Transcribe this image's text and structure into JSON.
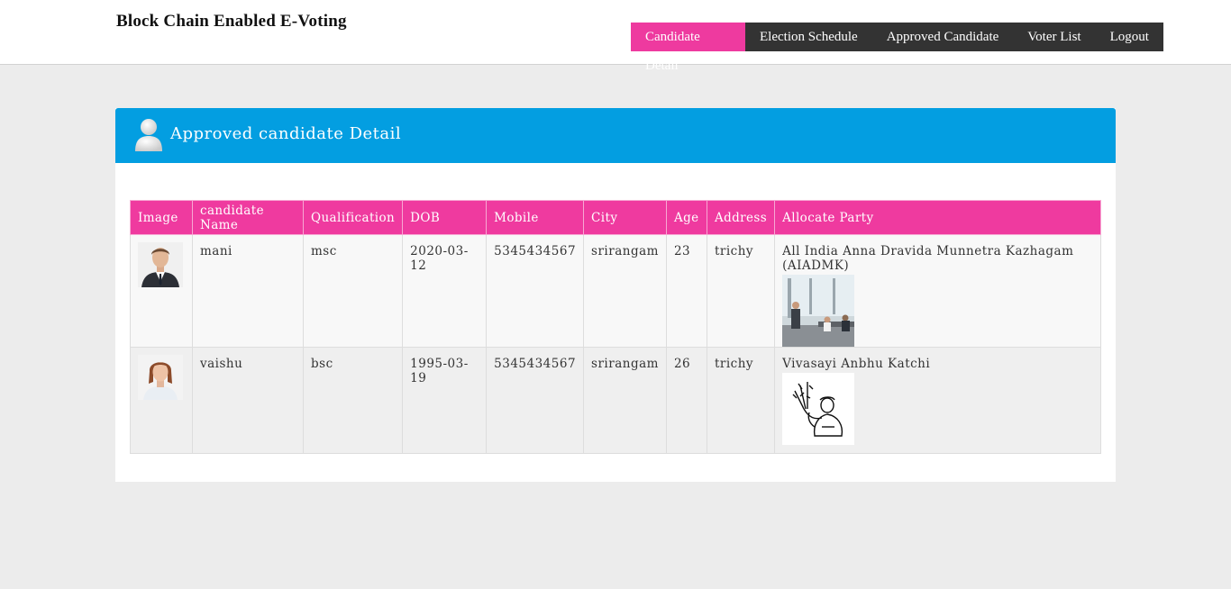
{
  "header": {
    "brand": "Block Chain Enabled E-Voting",
    "nav": [
      {
        "label": "Candidate Detail",
        "active": true
      },
      {
        "label": "Election Schedule",
        "active": false
      },
      {
        "label": "Approved Candidate",
        "active": false
      },
      {
        "label": "Voter List",
        "active": false
      },
      {
        "label": "Logout",
        "active": false
      }
    ]
  },
  "panel": {
    "title": "Approved candidate Detail",
    "icon": "user-icon"
  },
  "table": {
    "columns": [
      "Image",
      "candidate Name",
      "Qualification",
      "DOB",
      "Mobile",
      "City",
      "Age",
      "Address",
      "Allocate Party"
    ],
    "rows": [
      {
        "name": "mani",
        "qualification": "msc",
        "dob": "2020-03-12",
        "mobile": "5345434567",
        "city": "srirangam",
        "age": "23",
        "address": "trichy",
        "party": "All India Anna Dravida Munnetra Kazhagam (AIADMK)"
      },
      {
        "name": "vaishu",
        "qualification": "bsc",
        "dob": "1995-03-19",
        "mobile": "5345434567",
        "city": "srirangam",
        "age": "26",
        "address": "trichy",
        "party": "Vivasayi Anbhu Katchi"
      }
    ]
  },
  "colors": {
    "accent_pink": "#ee3a9f",
    "header_blue": "#039ee1",
    "nav_dark": "#333333",
    "page_bg": "#ececec"
  }
}
